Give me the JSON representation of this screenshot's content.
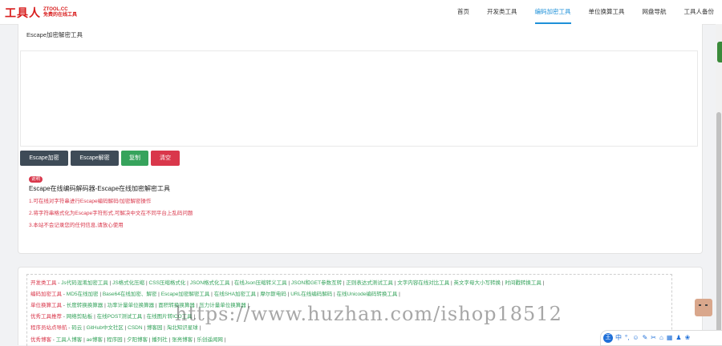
{
  "header": {
    "logo_text": "工具人",
    "logo_domain": "ZTOOL.CC",
    "logo_slogan": "免费的在线工具",
    "nav": [
      "首页",
      "开发类工具",
      "编码加密工具",
      "单位换算工具",
      "网盘导航",
      "工具人备份"
    ],
    "active_index": 2
  },
  "tool": {
    "title": "Escape加密解密工具",
    "input_value": "",
    "buttons": {
      "encrypt": "Escape加密",
      "decrypt": "Escape解密",
      "copy": "复制",
      "clear": "清空"
    }
  },
  "info": {
    "badge": "说明",
    "heading": "Escape在线编码解码器-Escape在线加密解密工具",
    "lines": [
      "1.可在线对字符串进行Escape编码解码/加密解密操作",
      "2.将字符串格式化为Escape字符形式,可解决中文在不同平台上乱码问题",
      "3.本站不会记录您的任何信息,请放心使用"
    ]
  },
  "links": {
    "rows": [
      {
        "category": "开发类工具",
        "items": [
          "Js代码混淆加密工具",
          "JS格式化压缩",
          "CSS压缩格式化",
          "JSON格式化工具",
          "在线Json压缩转义工具",
          "JSON和GET参数互转",
          "正则表达式测试工具",
          "文字内容在线对比工具",
          "英文字母大小写转换",
          "时间戳转换工具"
        ]
      },
      {
        "category": "编码加密工具",
        "items": [
          "MD5在线加密",
          "Base64在线加密、解密",
          "Escape加密解密工具",
          "在线SHA加密工具",
          "摩尔斯电码",
          "URL在线编码解码",
          "在线Unicode编码转换工具"
        ]
      },
      {
        "category": "单位换算工具",
        "items": [
          "长度转换换算器",
          "功率计量单位换算器",
          "面积转换换算器",
          "压力计量单位换算器"
        ]
      },
      {
        "category": "优秀工具推荐",
        "items": [
          "网络剪贴板",
          "在线POST测试工具",
          "在线图片转ICO工具"
        ]
      },
      {
        "category": "程序员站点导航",
        "items": [
          "码云",
          "GitHub中文社区",
          "CSDN",
          "博客园",
          "淘北知识星球"
        ]
      },
      {
        "category": "优秀博客",
        "items": [
          "工具人博客",
          "ae博客",
          "程序园",
          "夕阳博客",
          "播列社",
          "张亮博客",
          "乐创遥闻网"
        ]
      }
    ]
  },
  "watermark": "https://www.huzhan.com/ishop18512",
  "toolbar": {
    "main": "王",
    "icons": [
      "中",
      "°,",
      "☺",
      "✎",
      "✂",
      "⌂",
      "▦",
      "♟",
      "❀"
    ]
  },
  "colors": {
    "accent": "#1e90d8",
    "danger": "#d9374b",
    "success": "#36a35c",
    "dark": "#3e4b57"
  }
}
